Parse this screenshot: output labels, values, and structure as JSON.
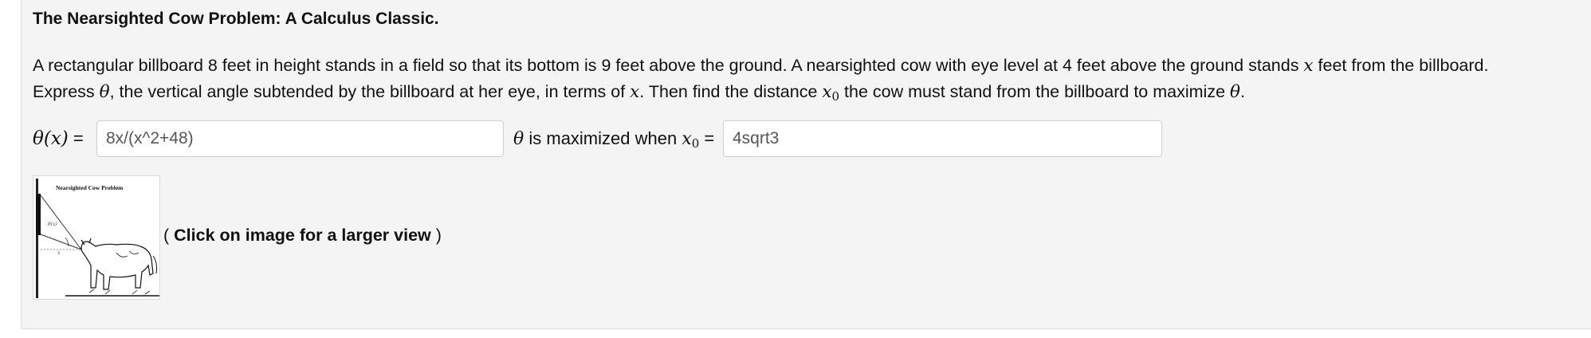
{
  "problem": {
    "title": "The Nearsighted Cow Problem: A Calculus Classic.",
    "line1_a": "A rectangular billboard 8 feet in height stands in a field so that its bottom is 9 feet above the ground. A nearsighted cow with eye level at 4 feet above the ground stands ",
    "var_x": "x",
    "line1_b": " feet from the billboard.",
    "line2_a": "Express ",
    "var_theta": "θ",
    "line2_b": ", the vertical angle subtended by the billboard at her eye, in terms of ",
    "line2_c": ". Then find the distance ",
    "var_x0": "x",
    "sub_0": "0",
    "line2_d": " the cow must stand from the billboard to maximize ",
    "line2_e": "."
  },
  "answers": {
    "theta_label_math": "θ(x)",
    "theta_label_eq": " = ",
    "theta_value": "8x/(x^2+48)",
    "max_label_theta": "θ",
    "max_label_text": " is maximized when ",
    "max_label_x": "x",
    "max_label_sub": "0",
    "max_label_eq": " = ",
    "max_value": "4sqrt3"
  },
  "figure": {
    "image_title": "Nearsighted Cow Problem",
    "caption_open": "( ",
    "caption_bold": "Click on image for a larger view",
    "caption_close": " )"
  }
}
